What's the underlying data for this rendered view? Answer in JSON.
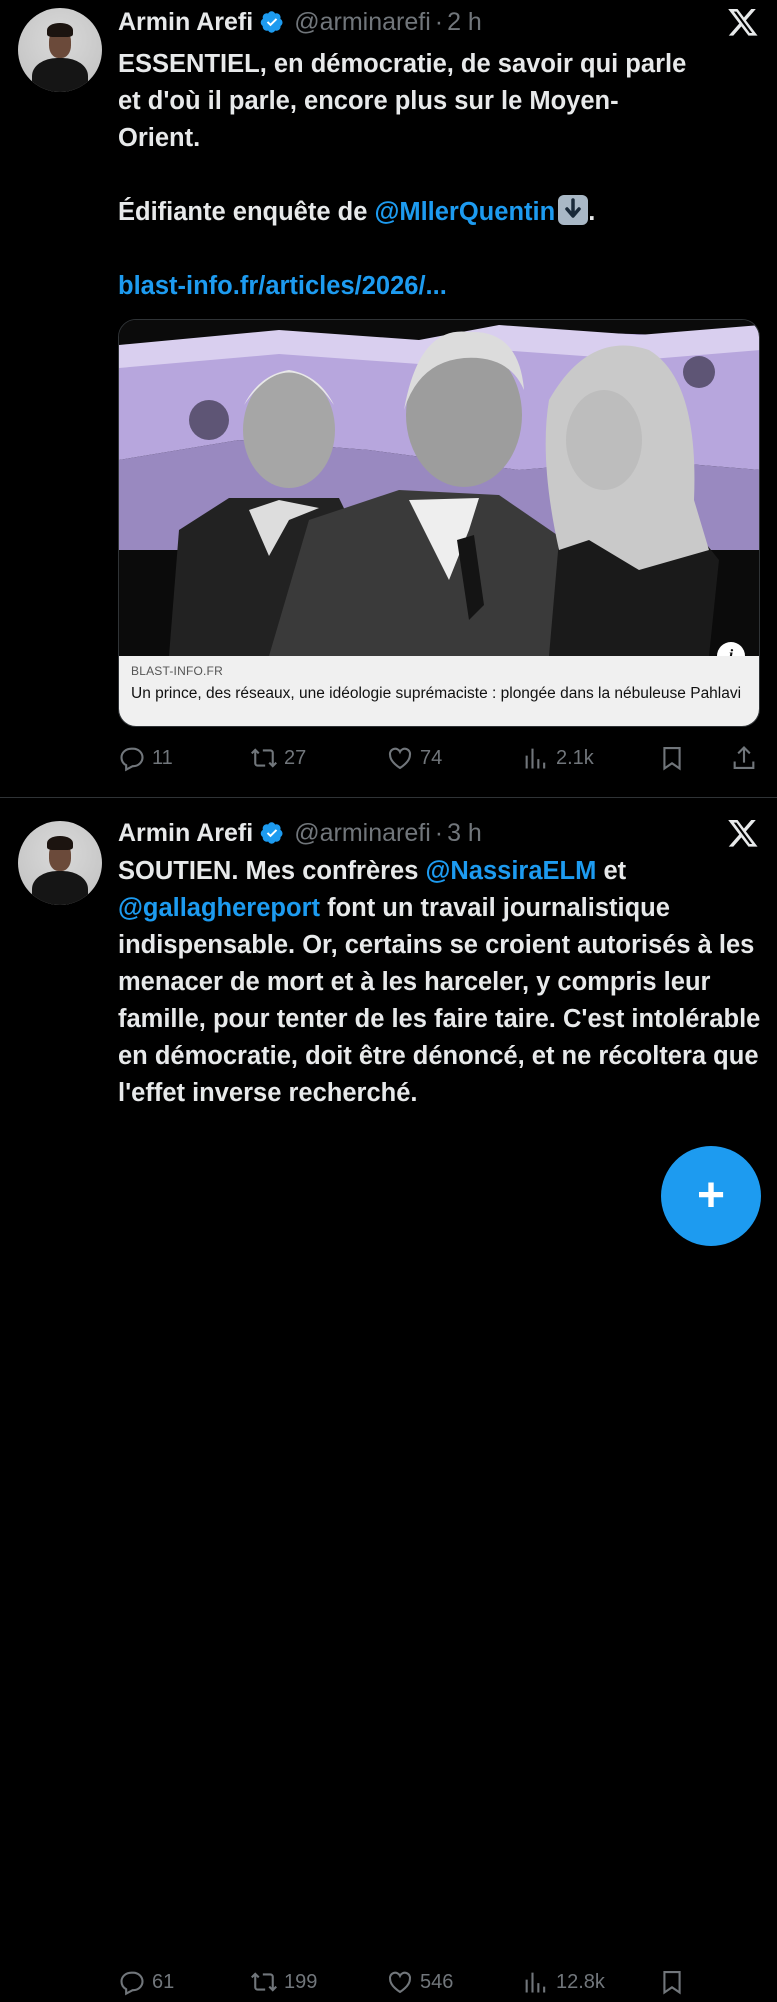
{
  "tweets": [
    {
      "author": "Armin Arefi",
      "handle": "@arminarefi",
      "dot": "·",
      "time": "2 h",
      "text_lines": [
        "ESSENTIEL, en démocratie, de savoir qui parle",
        "et d'où il parle, encore plus sur le Moyen-",
        "Orient."
      ],
      "line2_prefix": "Édifiante enquête de ",
      "mention": "@MllerQuentin",
      "line2_suffix": ".",
      "link": "blast-info.fr/articles/2026/...",
      "card": {
        "domain": "BLAST-INFO.FR",
        "title": "Un prince, des réseaux, une idéologie suprémaciste : plongée dans la nébuleuse Pahlavi",
        "info": "i"
      },
      "stats": {
        "replies": "11",
        "reposts": "27",
        "likes": "74",
        "views": "2.1k"
      }
    },
    {
      "author": "Armin Arefi",
      "handle": "@arminarefi",
      "dot": "·",
      "time": "3 h",
      "p1": "SOUTIEN. Mes confrères ",
      "m1": "@NassiraELM",
      "p2": " et",
      "m2": "@gallaghereport",
      "p3": " font un travail journalistique indispensable. Or, certains se croient autorisés à les menacer de mort et à les harceler, y compris leur famille, pour tenter de les faire taire. C'est intolérable en démocratie, doit être dénoncé, et ne récoltera que l'effet inverse recherché.",
      "stats": {
        "replies": "61",
        "reposts": "199",
        "likes": "546",
        "views": "12.8k"
      }
    }
  ],
  "fab": {
    "label": "+"
  },
  "colors": {
    "accent": "#1d9bf0",
    "muted": "#71767b",
    "text": "#e7e9ea",
    "bg": "#000000"
  }
}
